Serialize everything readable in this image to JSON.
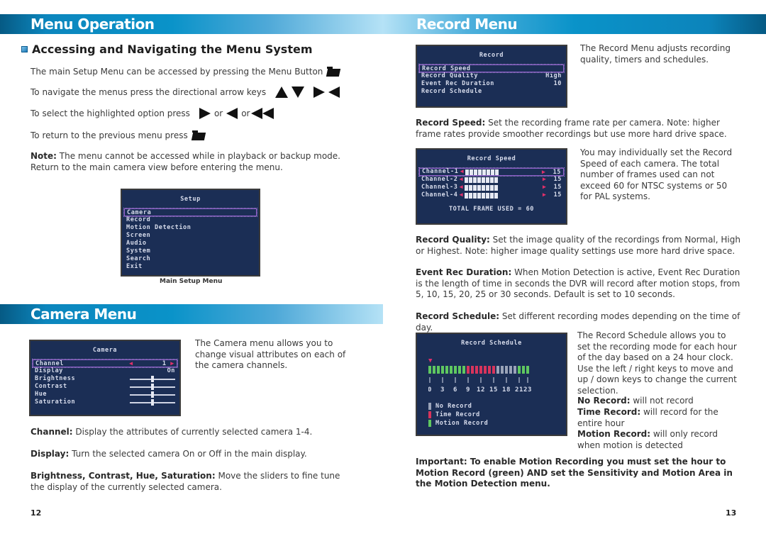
{
  "left_page": {
    "banner": "Menu Operation",
    "subheading": "Accessing and Navigating the Menu System",
    "instructions": {
      "menu_access": "The main Setup Menu can be accessed by pressing the Menu Button",
      "navigate": "To navigate the menus press the directional arrow keys",
      "select": "To select the highlighted option press",
      "select_or1": "or",
      "select_or2": "or",
      "return": "To return to the previous menu press"
    },
    "icons": {
      "menu_button": "folder-icon",
      "arrows": [
        "arrow-up-icon",
        "arrow-down-icon",
        "arrow-right-icon",
        "arrow-left-icon"
      ],
      "select_keys": [
        "arrow-right-icon",
        "arrow-left-icon",
        "rewind-icon"
      ],
      "return_button": "folder-icon"
    },
    "note": {
      "label": "Note:",
      "text": " The menu cannot be accessed while in playback or backup mode. Return to the main camera view before entering the menu."
    },
    "setup_screen": {
      "title": "Setup",
      "items": [
        "Camera",
        "Record",
        "Motion Detection",
        "Screen",
        "Audio",
        "System",
        "Search",
        "Exit"
      ],
      "selected": "Camera",
      "caption": "Main Setup Menu"
    },
    "camera_banner": "Camera Menu",
    "camera_screen": {
      "title": "Camera",
      "rows": [
        {
          "label": "Channel",
          "value": "1"
        },
        {
          "label": "Display",
          "value": "On"
        },
        {
          "label": "Brightness",
          "slider": 0.5
        },
        {
          "label": "Contrast",
          "slider": 0.5
        },
        {
          "label": "Hue",
          "slider": 0.5
        },
        {
          "label": "Saturation",
          "slider": 0.5
        }
      ]
    },
    "camera_intro": "The Camera menu allows you to change visual attributes on each of the camera channels.",
    "definitions": [
      {
        "term": "Channel:",
        "text": "  Display the attributes of currently selected camera 1-4."
      },
      {
        "term": "Display:",
        "text": "  Turn the selected camera On or Off in the main display."
      },
      {
        "term": "Brightness, Contrast, Hue, Saturation:",
        "text": "  Move the sliders to fine tune the display of the currently selected camera."
      }
    ],
    "page_number": "12"
  },
  "right_page": {
    "banner": "Record Menu",
    "record_screen": {
      "title": "Record",
      "rows": [
        {
          "label": "Record Speed",
          "value": ""
        },
        {
          "label": "Record Quality",
          "value": "High"
        },
        {
          "label": "Event Rec Duration",
          "value": "10"
        },
        {
          "label": "Record Schedule",
          "value": ""
        }
      ]
    },
    "record_intro": "The Record Menu adjusts recording quality, timers and schedules.",
    "record_speed": {
      "term": "Record Speed:",
      "text": "  Set the recording frame rate per camera.  Note: higher frame rates provide smoother recordings but use more hard drive space."
    },
    "speed_screen": {
      "title": "Record Speed",
      "channels": [
        {
          "label": "Channel-1",
          "value": "15"
        },
        {
          "label": "Channel-2",
          "value": "15"
        },
        {
          "label": "Channel-3",
          "value": "15"
        },
        {
          "label": "Channel-4",
          "value": "15"
        }
      ],
      "total": "TOTAL FRAME USED = 60"
    },
    "speed_note": "You may individually set the Record Speed of each camera.  The total number of frames used can not exceed 60 for NTSC systems or 50 for PAL systems.",
    "record_quality": {
      "term": "Record Quality:",
      "text": "  Set the image quality of the recordings from Normal, High or Highest.  Note: higher image quality settings use more hard drive space."
    },
    "event_rec": {
      "term": "Event Rec Duration:",
      "text": "  When Motion Detection is active, Event Rec Duration is the length of time in seconds the DVR will record after motion stops, from 5, 10, 15, 20, 25 or 30 seconds.  Default is set to 10 seconds."
    },
    "record_schedule": {
      "term": "Record Schedule:",
      "text": "  Set different recording modes depending on the time of day."
    },
    "schedule_screen": {
      "title": "Record Schedule",
      "hours": [
        "motion",
        "motion",
        "motion",
        "motion",
        "motion",
        "motion",
        "motion",
        "motion",
        "motion",
        "time",
        "time",
        "time",
        "time",
        "time",
        "time",
        "time",
        "none",
        "none",
        "none",
        "none",
        "none",
        "motion",
        "motion",
        "motion"
      ],
      "tick_labels": [
        "0",
        "3",
        "6",
        "9",
        "12",
        "15",
        "18",
        "21",
        "23"
      ],
      "legend": [
        {
          "label": "No Record",
          "mode": "none"
        },
        {
          "label": "Time Record",
          "mode": "time"
        },
        {
          "label": "Motion Record",
          "mode": "motion"
        }
      ],
      "colors": {
        "none": "#9aa3b8",
        "time": "#d8345c",
        "motion": "#5fc860"
      }
    },
    "schedule_note": "The Record Schedule allows you to set the recording mode for each hour of the day based on a 24 hour clock.  Use the left / right keys to move and up / down keys to change the current selection.",
    "modes": [
      {
        "term": "No Record:",
        "text": " will not record"
      },
      {
        "term": "Time Record:",
        "text": " will record for the entire hour"
      },
      {
        "term": "Motion Record:",
        "text": " will only record when motion is detected"
      }
    ],
    "important": "Important:  To enable Motion Recording you must set the hour to Motion Record (green) AND set the Sensitivity and Motion Area in the Motion Detection menu.",
    "page_number": "13"
  }
}
